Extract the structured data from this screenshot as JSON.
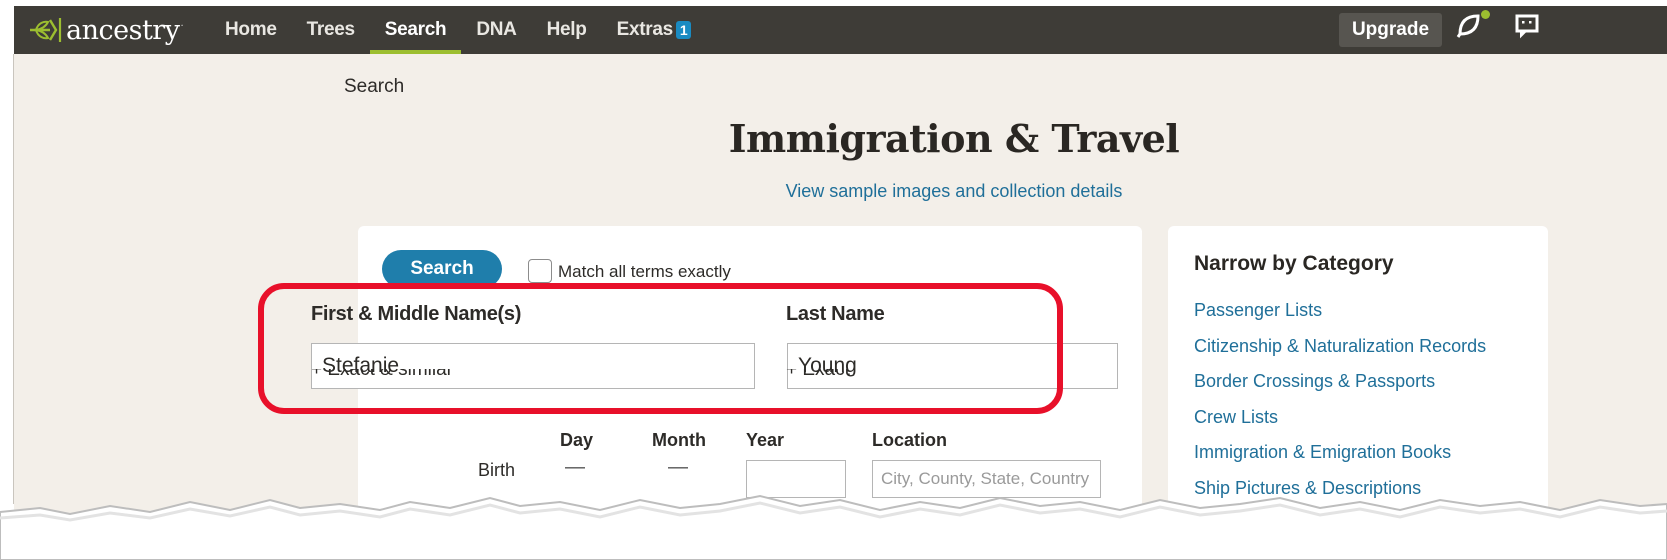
{
  "nav": {
    "brand": "ancestry",
    "links": [
      {
        "label": "Home"
      },
      {
        "label": "Trees"
      },
      {
        "label": "Search"
      },
      {
        "label": "DNA"
      },
      {
        "label": "Help"
      },
      {
        "label": "Extras"
      }
    ],
    "extras_badge": "1",
    "upgrade_label": "Upgrade",
    "icons": [
      "hint-leaf-icon",
      "messages-icon"
    ],
    "active_tab": "Search",
    "colors": {
      "nav_bg": "#3e3c37",
      "active_underline": "#9cbe30",
      "badge": "#1a8bc2"
    }
  },
  "breadcrumb": "Search",
  "page": {
    "title": "Immigration & Travel",
    "sample_link": "View sample images and collection details"
  },
  "form": {
    "search_button": "Search",
    "match_exact_label": "Match all terms exactly",
    "first_name_label": "First & Middle Name(s)",
    "first_name_value": "Stefanie",
    "last_name_label": "Last Name",
    "last_name_value": "Young",
    "first_name_option": "+ Exact & similar",
    "last_name_option": "+ Exact",
    "columns": {
      "day": "Day",
      "month": "Month",
      "year": "Year",
      "location": "Location"
    },
    "birth_label": "Birth",
    "birth_day": "—",
    "birth_month": "—",
    "birth_year": "",
    "location_placeholder": "City, County, State, Country"
  },
  "sidebar": {
    "title": "Narrow by Category",
    "categories": [
      {
        "label": "Passenger Lists"
      },
      {
        "label": "Citizenship & Naturalization Records"
      },
      {
        "label": "Border Crossings & Passports"
      },
      {
        "label": "Crew Lists"
      },
      {
        "label": "Immigration & Emigration Books"
      },
      {
        "label": "Ship Pictures & Descriptions"
      }
    ]
  },
  "annotation": {
    "highlight_color": "#e8102a"
  }
}
